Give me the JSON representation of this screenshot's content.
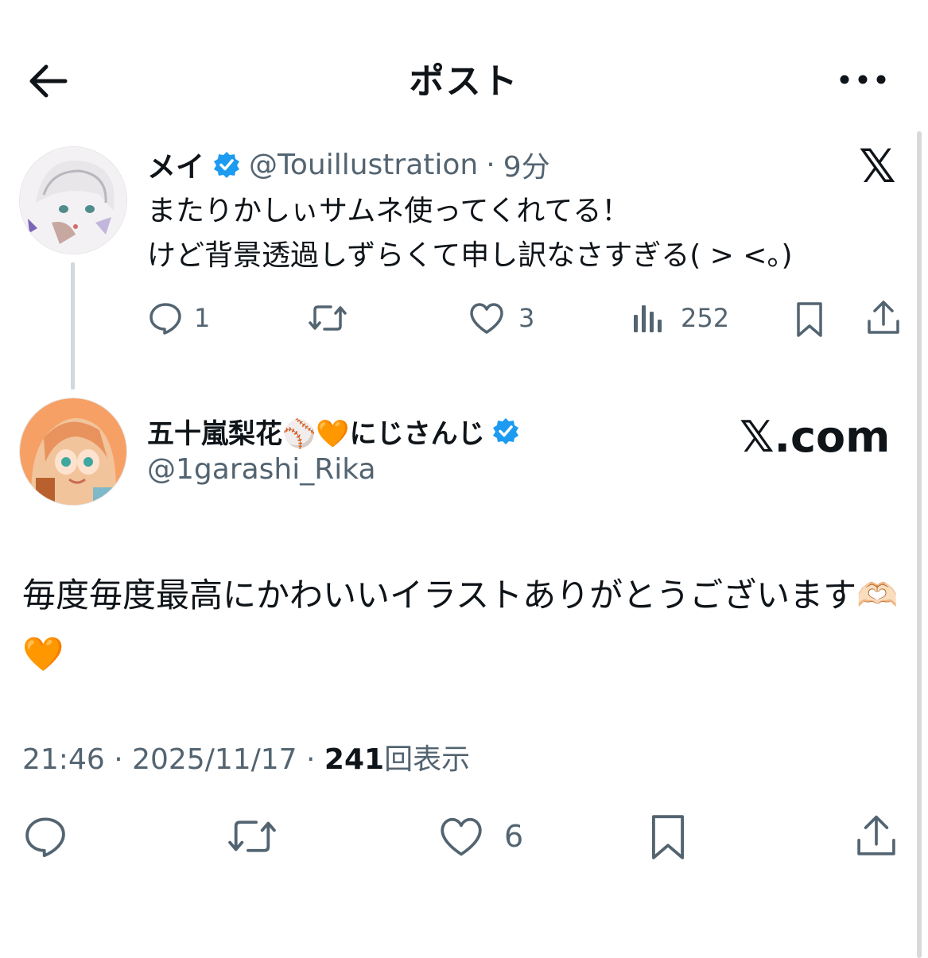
{
  "header": {
    "title": "ポスト"
  },
  "quoted_tweet": {
    "display_name": "メイ",
    "handle": "@Touillustration",
    "separator": "·",
    "time_ago": "9分",
    "text_lines": [
      "またりかしぃサムネ使ってくれてる！",
      "けど背景透過しずらくて申し訳なさすぎる( > <。)"
    ],
    "actions": {
      "reply_count": "1",
      "retweet_count": "",
      "like_count": "3",
      "view_count": "252"
    },
    "source_logo": "𝕏"
  },
  "main_tweet": {
    "display_name": "五十嵐梨花⚾🧡にじさんじ",
    "handle": "@1garashi_Rika",
    "watermark": "𝕏.com",
    "text": "毎度毎度最高にかわいいイラストありがとうございます🫶🏻🧡",
    "timestamp": "21:46 · 2025/11/17 ·",
    "view_count": "241",
    "view_label": "回表示",
    "actions": {
      "like_count": "6"
    }
  },
  "icons": {
    "back": "arrow-left-icon",
    "more": "more-horizontal-icon",
    "verified": "verified-badge-icon",
    "reply": "comment-icon",
    "retweet": "retweet-icon",
    "like": "heart-icon",
    "views": "analytics-icon",
    "bookmark": "bookmark-icon",
    "share": "share-icon"
  },
  "colors": {
    "verified_blue": "#1d9bf0",
    "muted_gray": "#536471",
    "thread_line": "#cfd9de"
  }
}
